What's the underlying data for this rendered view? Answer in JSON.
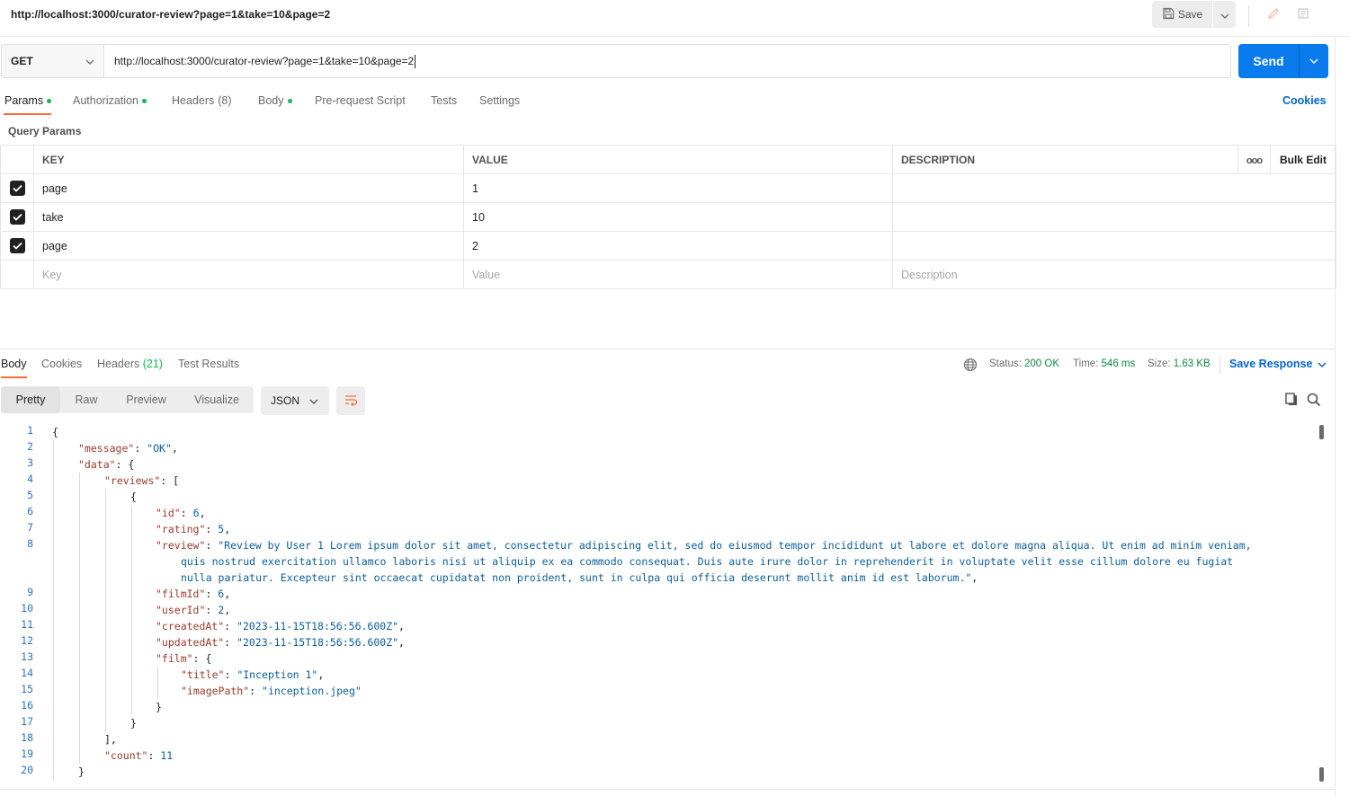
{
  "header": {
    "title": "http://localhost:3000/curator-review?page=1&take=10&page=2",
    "save_label": "Save"
  },
  "request": {
    "method": "GET",
    "url": "http://localhost:3000/curator-review?page=1&take=10&page=2",
    "send_label": "Send"
  },
  "req_tabs": {
    "params": "Params",
    "authorization": "Authorization",
    "headers": "Headers",
    "headers_count": "(8)",
    "body": "Body",
    "prerequest": "Pre-request Script",
    "tests": "Tests",
    "settings": "Settings",
    "cookies": "Cookies"
  },
  "query_params": {
    "title": "Query Params",
    "columns": {
      "key": "KEY",
      "value": "VALUE",
      "description": "DESCRIPTION",
      "bulk_edit": "Bulk Edit",
      "more": "ooo"
    },
    "rows": [
      {
        "key": "page",
        "value": "1",
        "description": ""
      },
      {
        "key": "take",
        "value": "10",
        "description": ""
      },
      {
        "key": "page",
        "value": "2",
        "description": ""
      }
    ],
    "placeholders": {
      "key": "Key",
      "value": "Value",
      "description": "Description"
    }
  },
  "response": {
    "tabs": {
      "body": "Body",
      "cookies": "Cookies",
      "headers": "Headers",
      "headers_count": "(21)",
      "test_results": "Test Results"
    },
    "status_label": "Status:",
    "status_value": "200 OK",
    "time_label": "Time:",
    "time_value": "546 ms",
    "size_label": "Size:",
    "size_value": "1.63 KB",
    "save_response": "Save Response",
    "views": {
      "pretty": "Pretty",
      "raw": "Raw",
      "preview": "Preview",
      "visualize": "Visualize"
    },
    "format": "JSON"
  },
  "code": {
    "line_numbers": [
      "1",
      "2",
      "3",
      "4",
      "5",
      "6",
      "7",
      "8",
      "9",
      "10",
      "11",
      "12",
      "13",
      "14",
      "15",
      "16",
      "17",
      "18",
      "19",
      "20"
    ],
    "l1": "{",
    "l2_key": "\"message\"",
    "l2_val": "\"OK\"",
    "l3_key": "\"data\"",
    "l4_key": "\"reviews\"",
    "l6_key": "\"id\"",
    "l6_val": "6",
    "l7_key": "\"rating\"",
    "l7_val": "5",
    "l8_key": "\"review\"",
    "l8_val_a": "\"Review by User 1 Lorem ipsum dolor sit amet, consectetur adipiscing elit, sed do eiusmod tempor incididunt ut labore et dolore magna aliqua. Ut enim ad minim veniam,",
    "l8_val_b": "quis nostrud exercitation ullamco laboris nisi ut aliquip ex ea commodo consequat. Duis aute irure dolor in reprehenderit in voluptate velit esse cillum dolore eu fugiat",
    "l8_val_c": "nulla pariatur. Excepteur sint occaecat cupidatat non proident, sunt in culpa qui officia deserunt mollit anim id est laborum.\"",
    "l9_key": "\"filmId\"",
    "l9_val": "6",
    "l10_key": "\"userId\"",
    "l10_val": "2",
    "l11_key": "\"createdAt\"",
    "l11_val": "\"2023-11-15T18:56:56.600Z\"",
    "l12_key": "\"updatedAt\"",
    "l12_val": "\"2023-11-15T18:56:56.600Z\"",
    "l13_key": "\"film\"",
    "l14_key": "\"title\"",
    "l14_val": "\"Inception 1\"",
    "l15_key": "\"imagePath\"",
    "l15_val": "\"inception.jpeg\"",
    "l19_key": "\"count\"",
    "l19_val": "11"
  }
}
